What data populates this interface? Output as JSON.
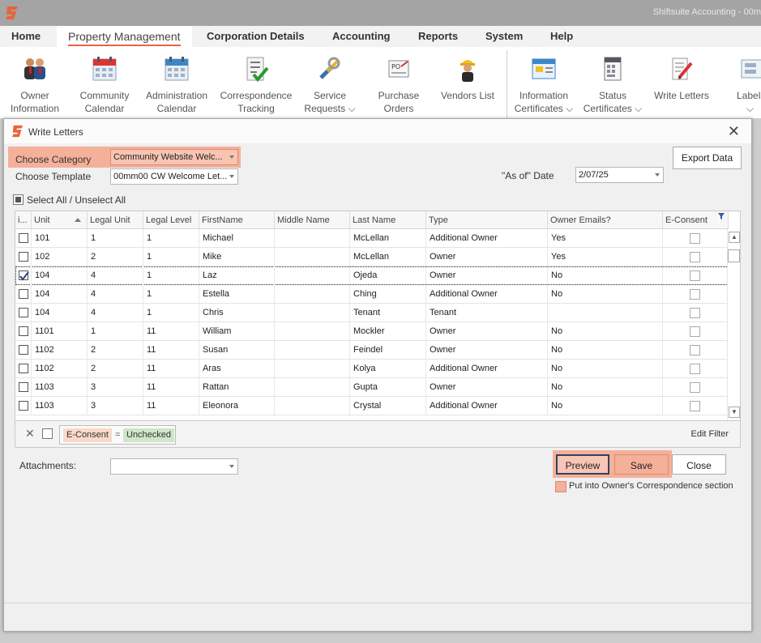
{
  "app": {
    "title": "Shiftsuite Accounting - 00m",
    "logo": "shiftsuite-logo-icon"
  },
  "menu": [
    {
      "label": "Home"
    },
    {
      "label": "Property Management"
    },
    {
      "label": "Corporation Details"
    },
    {
      "label": "Accounting"
    },
    {
      "label": "Reports"
    },
    {
      "label": "System"
    },
    {
      "label": "Help"
    }
  ],
  "ribbon": [
    {
      "line1": "Owner",
      "line2": "Information",
      "icon": "owners-icon"
    },
    {
      "line1": "Community",
      "line2": "Calendar",
      "icon": "calendar-icon"
    },
    {
      "line1": "Administration",
      "line2": "Calendar",
      "icon": "calendar-icon"
    },
    {
      "line1": "Correspondence",
      "line2": "Tracking",
      "icon": "checklist-icon"
    },
    {
      "line1": "Service",
      "line2": "Requests ⌵",
      "icon": "tools-icon"
    },
    {
      "line1": "Purchase",
      "line2": "Orders",
      "icon": "purchase-order-icon"
    },
    {
      "line1": "Vendors List",
      "line2": "",
      "icon": "worker-icon"
    },
    {
      "line1": "Information",
      "line2": "Certificates ⌵",
      "icon": "certificate-icon"
    },
    {
      "line1": "Status",
      "line2": "Certificates ⌵",
      "icon": "status-doc-icon"
    },
    {
      "line1": "Write Letters",
      "line2": "",
      "icon": "write-icon"
    },
    {
      "line1": "Labels",
      "line2": "⌵",
      "icon": "labels-icon"
    }
  ],
  "dialog": {
    "title": "Write Letters",
    "choose_category_label": "Choose Category",
    "choose_category_value": "Community Website Welc...",
    "choose_template_label": "Choose Template",
    "choose_template_value": "00mm00 CW Welcome Let...",
    "as_of_label": "\"As of\" Date",
    "as_of_value": "2/07/25",
    "export_label": "Export Data",
    "select_all_label": "Select All / Unselect All",
    "columns": [
      "i...",
      "Unit",
      "Legal Unit",
      "Legal Level",
      "FirstName",
      "Middle Name",
      "Last Name",
      "Type",
      "Owner Emails?",
      "E-Consent"
    ],
    "rows": [
      {
        "checked": false,
        "unit": "101",
        "legal_unit": "1",
        "legal_level": "1",
        "first": "Michael",
        "middle": "",
        "last": "McLellan",
        "type": "Additional Owner",
        "emails": "Yes"
      },
      {
        "checked": false,
        "unit": "102",
        "legal_unit": "2",
        "legal_level": "1",
        "first": "Mike",
        "middle": "",
        "last": "McLellan",
        "type": "Owner",
        "emails": "Yes"
      },
      {
        "checked": true,
        "unit": "104",
        "legal_unit": "4",
        "legal_level": "1",
        "first": "Laz",
        "middle": "",
        "last": "Ojeda",
        "type": "Owner",
        "emails": "No"
      },
      {
        "checked": false,
        "unit": "104",
        "legal_unit": "4",
        "legal_level": "1",
        "first": "Estella",
        "middle": "",
        "last": "Ching",
        "type": "Additional Owner",
        "emails": "No"
      },
      {
        "checked": false,
        "unit": "104",
        "legal_unit": "4",
        "legal_level": "1",
        "first": "Chris",
        "middle": "",
        "last": "Tenant",
        "type": "Tenant",
        "emails": ""
      },
      {
        "checked": false,
        "unit": "1101",
        "legal_unit": "1",
        "legal_level": "11",
        "first": "William",
        "middle": "",
        "last": "Mockler",
        "type": "Owner",
        "emails": "No"
      },
      {
        "checked": false,
        "unit": "1102",
        "legal_unit": "2",
        "legal_level": "11",
        "first": "Susan",
        "middle": "",
        "last": "Feindel",
        "type": "Owner",
        "emails": "No"
      },
      {
        "checked": false,
        "unit": "1102",
        "legal_unit": "2",
        "legal_level": "11",
        "first": "Aras",
        "middle": "",
        "last": "Kolya",
        "type": "Additional Owner",
        "emails": "No"
      },
      {
        "checked": false,
        "unit": "1103",
        "legal_unit": "3",
        "legal_level": "11",
        "first": "Rattan",
        "middle": "",
        "last": "Gupta",
        "type": "Owner",
        "emails": "No"
      },
      {
        "checked": false,
        "unit": "1103",
        "legal_unit": "3",
        "legal_level": "11",
        "first": "Eleonora",
        "middle": "",
        "last": "Crystal",
        "type": "Additional Owner",
        "emails": "No"
      }
    ],
    "filter": {
      "field": "E-Consent",
      "operator": "=",
      "value": "Unchecked",
      "edit_label": "Edit Filter"
    },
    "attachments_label": "Attachments:",
    "attachments_value": "",
    "preview_label": "Preview",
    "save_label": "Save",
    "close_label": "Close",
    "correspondence_label": "Put into Owner's Correspondence section"
  },
  "colors": {
    "accent": "#e8643c",
    "highlight": "#f5b09a",
    "filter_field_bg": "#fad9c8",
    "filter_value_bg": "#cfe6c9"
  }
}
